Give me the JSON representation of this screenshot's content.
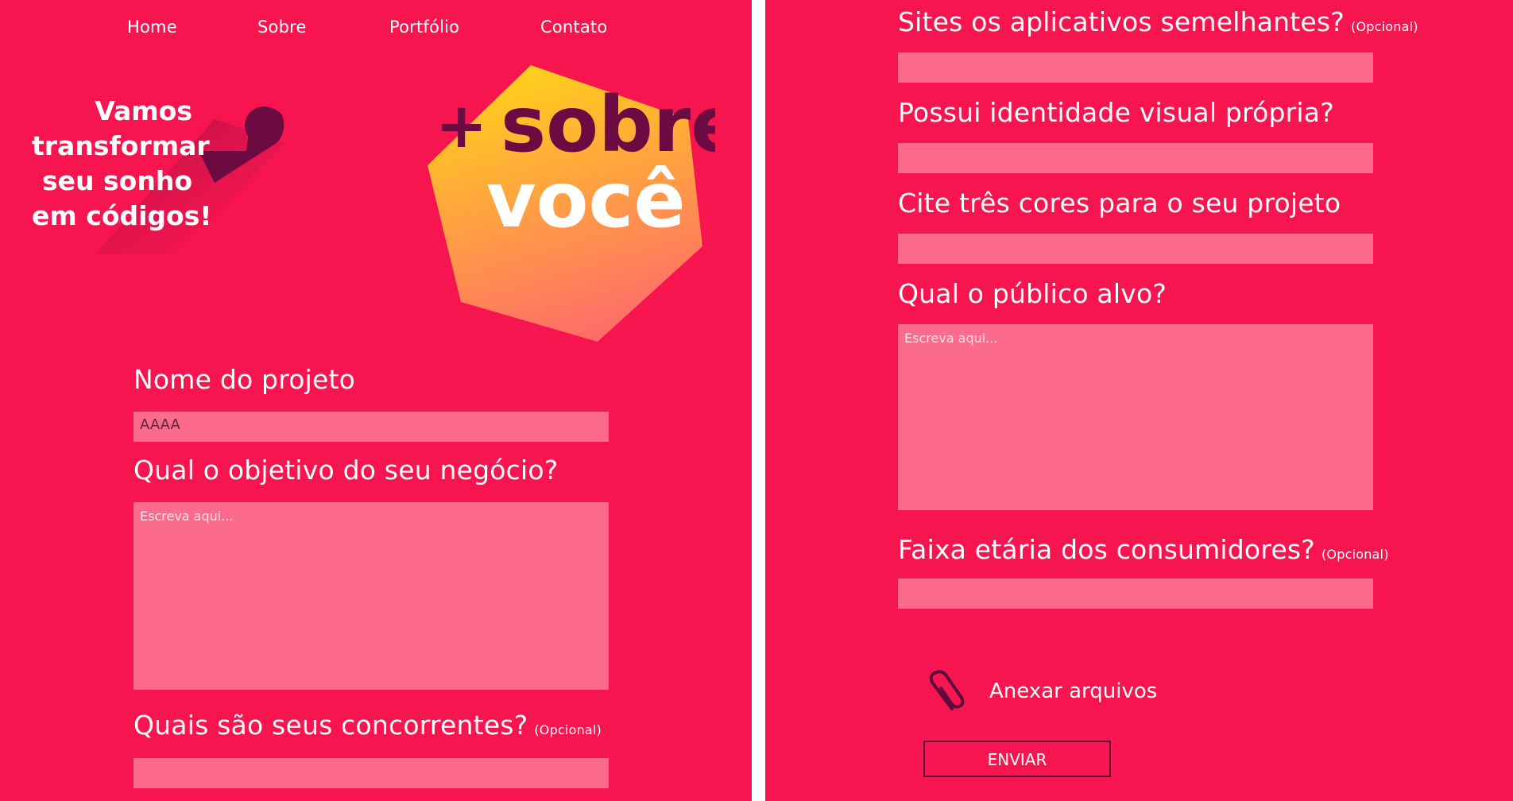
{
  "nav": {
    "items": [
      "Home",
      "Sobre",
      "Portfólio",
      "Contato"
    ]
  },
  "hero": {
    "tagline": [
      "Vamos",
      "transformar",
      "seu sonho",
      "em códigos!"
    ],
    "title_prefix": "+",
    "title_word1": "sobre",
    "title_word2": "você"
  },
  "form_left": {
    "project_name": {
      "label": "Nome do projeto",
      "value": "AAAA"
    },
    "business_goal": {
      "label": "Qual o objetivo do seu negócio?",
      "placeholder": "Escreva aqui..."
    },
    "competitors": {
      "label": "Quais são seus concorrentes?",
      "optional": "(Opcional)",
      "value": ""
    }
  },
  "form_right": {
    "similar_sites": {
      "label": "Sites os aplicativos semelhantes?",
      "optional": "(Opcional)",
      "value": ""
    },
    "visual_identity": {
      "label": "Possui identidade visual própria?",
      "value": ""
    },
    "colors": {
      "label": "Cite três cores para o seu projeto",
      "value": ""
    },
    "audience": {
      "label": "Qual o público alvo?",
      "placeholder": "Escreva aqui..."
    },
    "age_range": {
      "label": "Faixa etária dos consumidores?",
      "optional": "(Opcional)",
      "value": ""
    },
    "attach_label": "Anexar arquivos",
    "submit_label": "ENVIAR"
  },
  "colors": {
    "background": "#f7154f",
    "field": "#fc6a8d",
    "dark_accent": "#5c0a3b",
    "gradient_top": "#ffd21a",
    "gradient_bottom": "#ff6b6b"
  },
  "icons": {
    "attach": "paperclip-icon"
  }
}
